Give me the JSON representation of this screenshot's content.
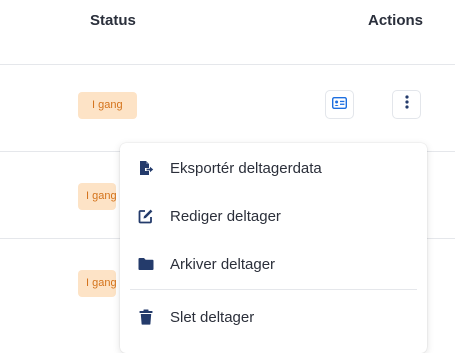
{
  "table": {
    "columns": {
      "status": "Status",
      "actions": "Actions"
    },
    "rows": [
      {
        "status": "I gang"
      },
      {
        "status": "I gang"
      },
      {
        "status": "I gang"
      }
    ]
  },
  "row_actions": {
    "card_icon": "id-card-icon",
    "more_icon": "vertical-ellipsis-icon"
  },
  "menu": {
    "items": [
      {
        "label": "Eksportér deltagerdata",
        "icon": "file-export-icon"
      },
      {
        "label": "Rediger deltager",
        "icon": "edit-icon"
      },
      {
        "label": "Arkiver deltager",
        "icon": "folder-icon"
      },
      {
        "label": "Slet deltager",
        "icon": "trash-icon"
      }
    ]
  },
  "colors": {
    "badge_bg": "#fde3c6",
    "badge_text": "#d4731b",
    "accent": "#1d6fe0",
    "icon_dark": "#243b6b"
  }
}
